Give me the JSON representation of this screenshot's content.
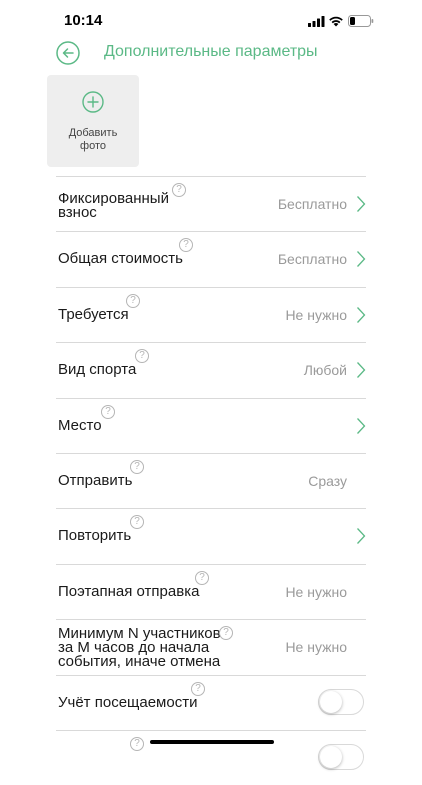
{
  "status_bar": {
    "time": "10:14"
  },
  "header": {
    "title": "Дополнительные параметры",
    "back_icon": "arrow-left-circle-icon"
  },
  "add_photo": {
    "label": "Добавить\nфото",
    "icon": "plus-circle-icon"
  },
  "colors": {
    "accent": "#5bb986",
    "value_text": "#9a9a9a",
    "divider": "#d9d9d9",
    "photo_bg": "#eeeeee"
  },
  "settings": [
    {
      "label": "Фиксированный\nвзнос",
      "help": "?",
      "value": "Бесплатно",
      "control": "chevron"
    },
    {
      "label": "Общая стоимость",
      "help": "?",
      "value": "Бесплатно",
      "control": "chevron"
    },
    {
      "label": "Требуется",
      "help": "?",
      "value": "Не нужно",
      "control": "chevron"
    },
    {
      "label": "Вид спорта",
      "help": "?",
      "value": "Любой",
      "control": "chevron"
    },
    {
      "label": "Место",
      "help": "?",
      "value": "",
      "control": "chevron"
    },
    {
      "label": "Отправить",
      "help": "?",
      "value": "Сразу",
      "control": "none"
    },
    {
      "label": "Повторить",
      "help": "?",
      "value": "",
      "control": "chevron"
    },
    {
      "label": "Поэтапная отправка",
      "help": "?",
      "value": "Не нужно",
      "control": "none"
    },
    {
      "label": "Минимум N участников\nза М часов до начала\nсобытия, иначе отмена",
      "help": "?",
      "value": "Не нужно",
      "control": "none"
    },
    {
      "label": "Учёт посещаемости",
      "help": "?",
      "value": "",
      "control": "toggle",
      "toggle_on": false
    },
    {
      "label": "",
      "help": "?",
      "value": "",
      "control": "toggle",
      "toggle_on": false
    }
  ]
}
